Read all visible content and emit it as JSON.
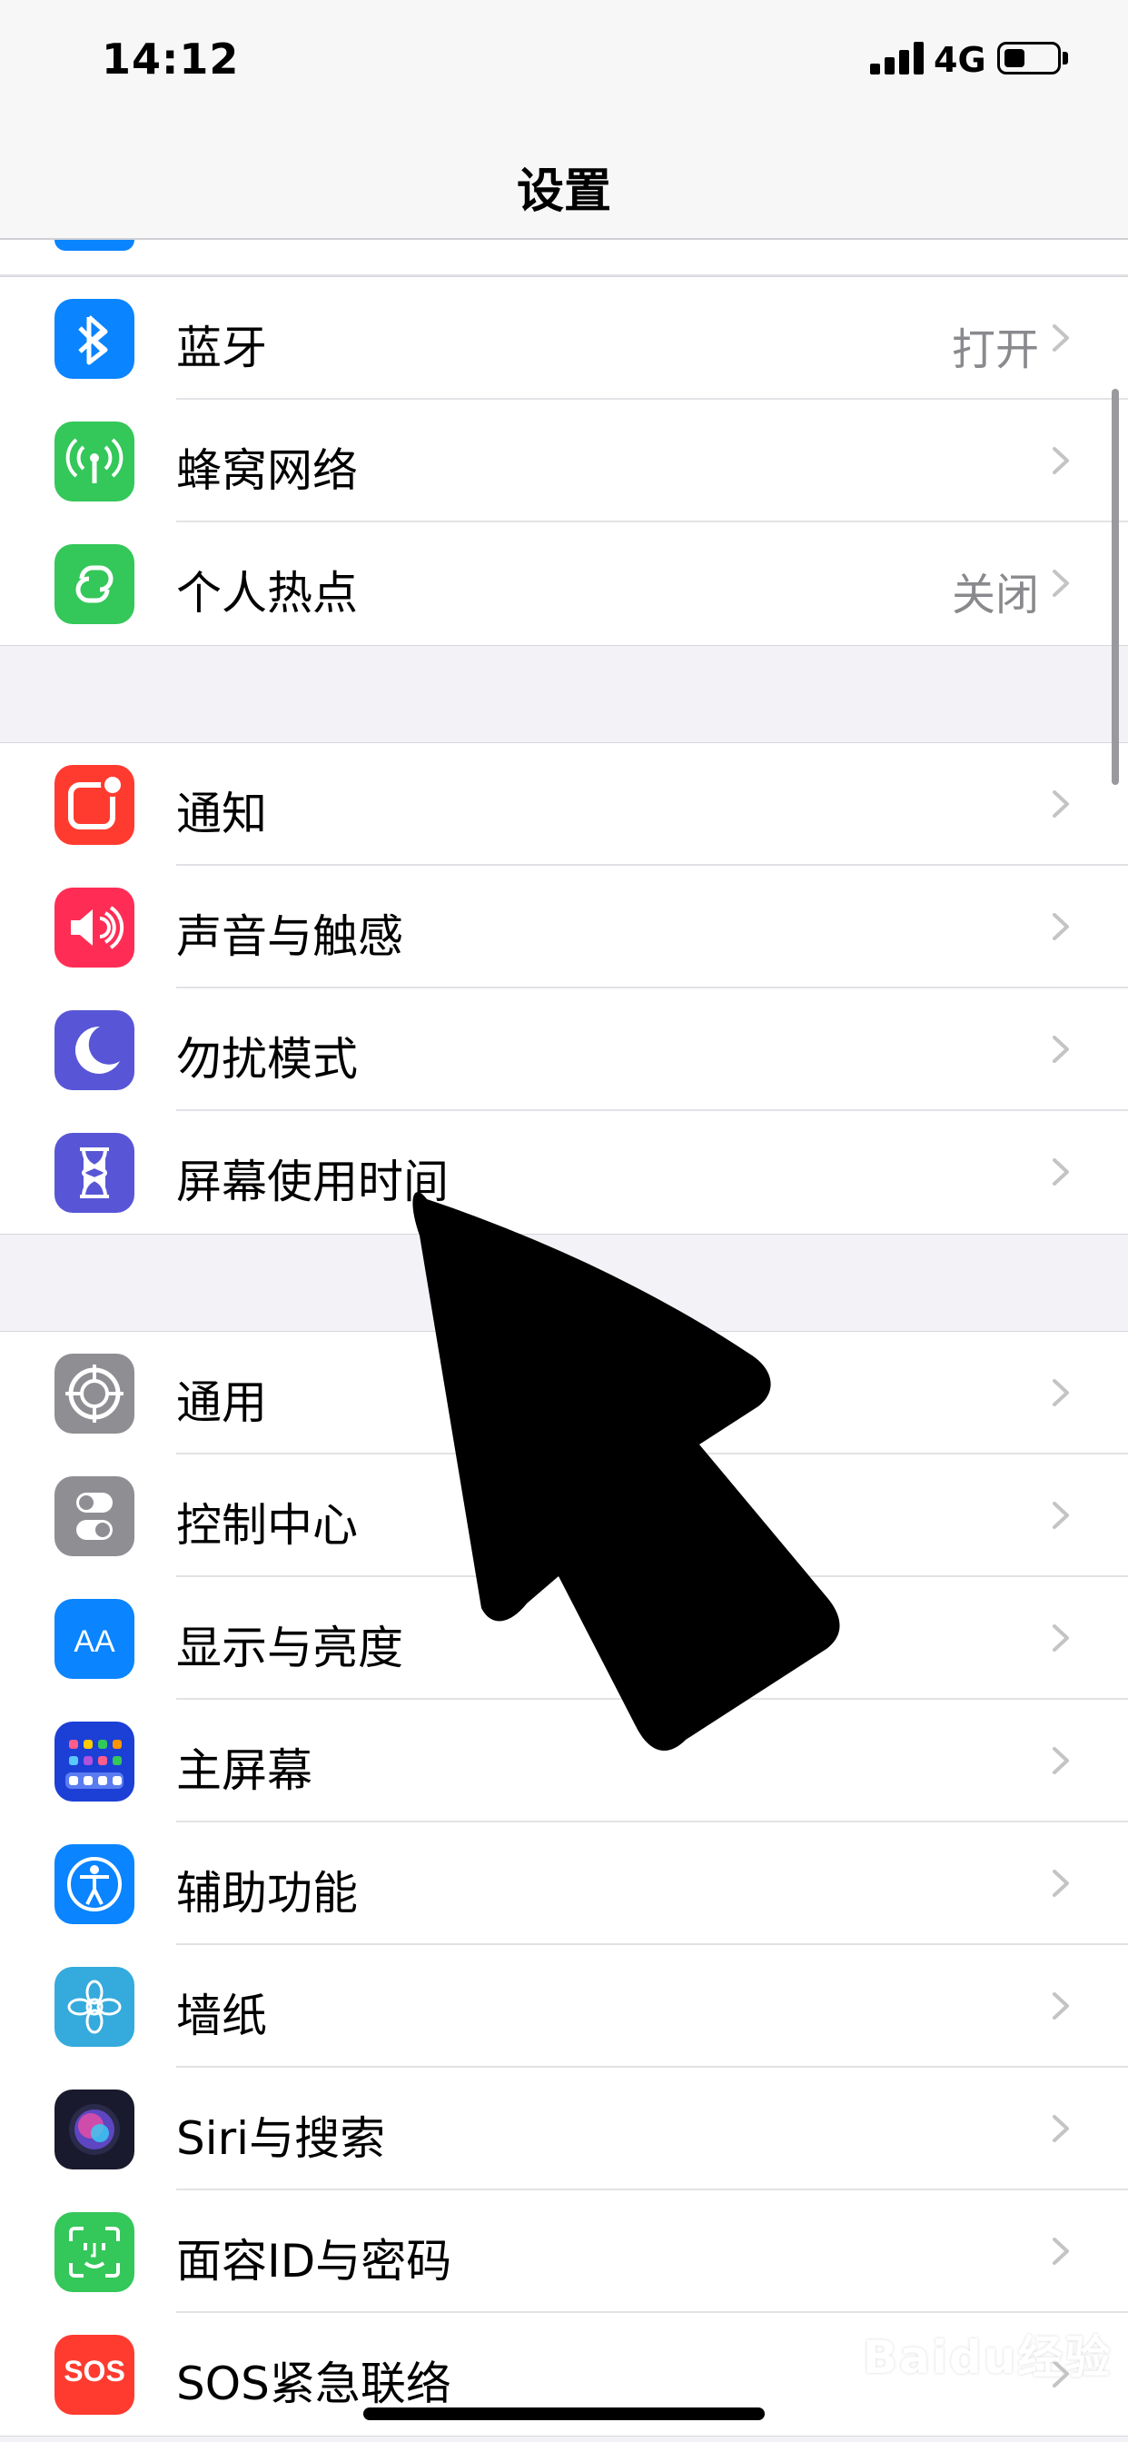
{
  "status": {
    "time": "14:12",
    "network": "4G"
  },
  "nav": {
    "title": "设置"
  },
  "groups": [
    {
      "rows": [
        {
          "label": "蓝牙",
          "value": "打开",
          "icon": "bluetooth-icon",
          "color": "#0a84ff"
        },
        {
          "label": "蜂窝网络",
          "value": "",
          "icon": "antenna-icon",
          "color": "#34c759"
        },
        {
          "label": "个人热点",
          "value": "关闭",
          "icon": "hotspot-link-icon",
          "color": "#34c759"
        }
      ]
    },
    {
      "rows": [
        {
          "label": "通知",
          "value": "",
          "icon": "notification-icon",
          "color": "#ff3b30"
        },
        {
          "label": "声音与触感",
          "value": "",
          "icon": "speaker-icon",
          "color": "#ff2d55"
        },
        {
          "label": "勿扰模式",
          "value": "",
          "icon": "moon-icon",
          "color": "#5856d6"
        },
        {
          "label": "屏幕使用时间",
          "value": "",
          "icon": "hourglass-icon",
          "color": "#5856d6"
        }
      ]
    },
    {
      "rows": [
        {
          "label": "通用",
          "value": "",
          "icon": "gear-icon",
          "color": "#8e8e93"
        },
        {
          "label": "控制中心",
          "value": "",
          "icon": "toggles-icon",
          "color": "#8e8e93"
        },
        {
          "label": "显示与亮度",
          "value": "",
          "icon": "text-size-icon",
          "color": "#0a84ff"
        },
        {
          "label": "主屏幕",
          "value": "",
          "icon": "home-grid-icon",
          "color": "#1c3fd6"
        },
        {
          "label": "辅助功能",
          "value": "",
          "icon": "accessibility-icon",
          "color": "#0a84ff"
        },
        {
          "label": "墙纸",
          "value": "",
          "icon": "flower-icon",
          "color": "#35aadc"
        },
        {
          "label": "Siri与搜索",
          "value": "",
          "icon": "siri-icon",
          "color": "#1a1a2e"
        },
        {
          "label": "面容ID与密码",
          "value": "",
          "icon": "face-id-icon",
          "color": "#34c759"
        },
        {
          "label": "SOS紧急联络",
          "value": "",
          "icon": "sos-icon",
          "color": "#ff3b30",
          "icon_text": "SOS"
        }
      ]
    }
  ],
  "watermark": "Baidu经验"
}
